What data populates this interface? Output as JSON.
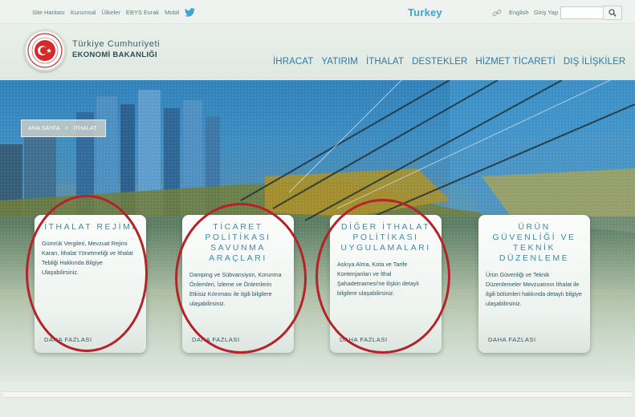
{
  "topbar": {
    "links": [
      "Site Haritası",
      "Kurumsal",
      "Ülkeler",
      "EBYS Evrak",
      "Mobil"
    ],
    "brand": "Turkey",
    "language": "English",
    "login": "Giriş Yap",
    "search_value": ""
  },
  "header": {
    "ministry_line1": "Türkiye Cumhuriyeti",
    "ministry_line2": "EKONOMİ BAKANLIĞI",
    "nav": [
      "İHRACAT",
      "YATIRIM",
      "İTHALAT",
      "DESTEKLER",
      "HİZMET TİCARETİ",
      "DIŞ İLİŞKİLER"
    ]
  },
  "breadcrumb": {
    "home": "ANA SAYFA",
    "separator": ">",
    "current": "İTHALAT"
  },
  "cards": [
    {
      "title": "İTHALAT REJİMİ",
      "text": "Gümrük Vergileri, Mevzuat Rejimi Kararı, İthalat Yönetmeliği ve İthalat Tebliği Hakkında Bilgiye Ulaşabilirsiniz.",
      "more": "DAHA FAZLASI"
    },
    {
      "title": "TİCARET POLİTİKASI SAVUNMA ARAÇLARI",
      "text": "Damping ve Sübvansiyon, Korunma Önlemleri, İzleme ve Önlemlerin Etkisiz Kılınması ile ilgili bilgilere ulaşabilirsiniz.",
      "more": "DAHA FAZLASI"
    },
    {
      "title": "DİĞER İTHALAT POLİTİKASI UYGULAMALARI",
      "text": "Askıya Alma, Kota ve Tarife Kontenjanları ve İthal Şahadetnamesi'ne ilişkin detaylı bilgilere ulaşabilirsiniz.",
      "more": "DAHA FAZLASI"
    },
    {
      "title": "ÜRÜN GÜVENLİĞİ VE TEKNİK DÜZENLEME",
      "text": "Ürün Güvenliği ve Teknik Düzenlemeler Mevzuatının İthalat ile ilgili bölümleri hakkında detaylı bilgiye ulaşabilirsiniz.",
      "more": "DAHA FAZLASI"
    }
  ],
  "colors": {
    "nav_blue": "#2e7aa5",
    "brand_blue": "#3ba6d1",
    "card_title": "#3e8ba8",
    "annotation_red": "#b3242a",
    "flag_red": "#d42a2a"
  },
  "icons": [
    "twitter-icon",
    "link-icon",
    "search-icon",
    "emblem-logo"
  ]
}
